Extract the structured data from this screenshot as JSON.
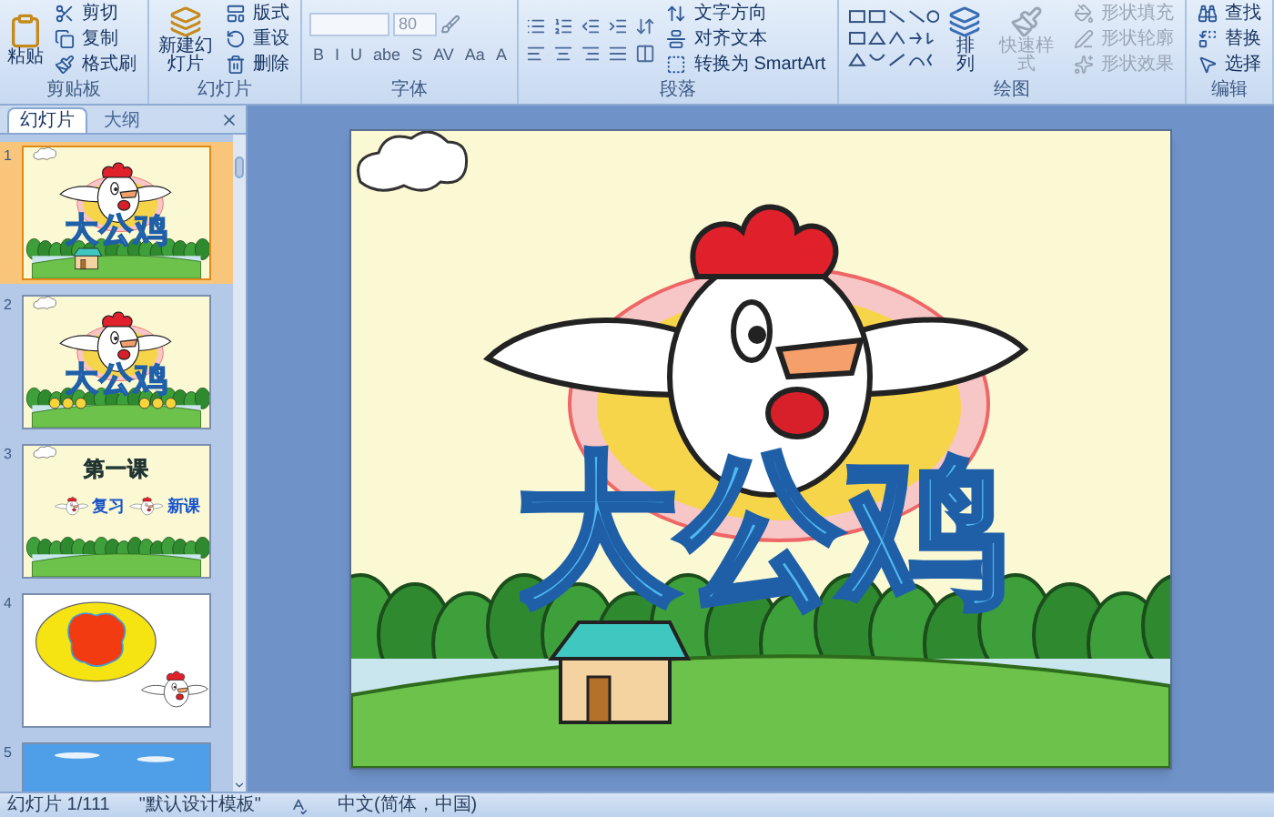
{
  "ribbon": {
    "clipboard": {
      "label": "剪贴板",
      "paste": "粘贴",
      "items": [
        {
          "label": "剪切",
          "kind": "cut"
        },
        {
          "label": "复制",
          "kind": "copy"
        },
        {
          "label": "格式刷",
          "kind": "brush"
        }
      ]
    },
    "slides": {
      "label": "幻灯片",
      "new_slide": "新建幻灯片",
      "items": [
        {
          "label": "版式",
          "kind": "layout"
        },
        {
          "label": "重设",
          "kind": "reset"
        },
        {
          "label": "删除",
          "kind": "delete"
        }
      ]
    },
    "font": {
      "label": "字体",
      "size": "80",
      "buttons": [
        "B",
        "I",
        "U",
        "abe",
        "S",
        "AV",
        "Aa",
        "A"
      ]
    },
    "paragraph": {
      "label": "段落",
      "items": [
        {
          "label": "文字方向",
          "kind": "direction"
        },
        {
          "label": "对齐文本",
          "kind": "align"
        },
        {
          "label": "转换为 SmartArt",
          "kind": "smartart"
        }
      ]
    },
    "drawing": {
      "label": "绘图",
      "arrange": "排列",
      "quick_styles": {
        "label": "快速样式",
        "disabled": true
      },
      "items": [
        {
          "label": "形状填充",
          "kind": "fill",
          "disabled": true
        },
        {
          "label": "形状轮廓",
          "kind": "outline",
          "disabled": true
        },
        {
          "label": "形状效果",
          "kind": "effect",
          "disabled": true
        }
      ]
    },
    "editing": {
      "label": "编辑",
      "items": [
        {
          "label": "查找",
          "kind": "find"
        },
        {
          "label": "替换",
          "kind": "replace"
        },
        {
          "label": "选择",
          "kind": "select"
        }
      ]
    }
  },
  "slide_panel": {
    "tabs": [
      {
        "label": "幻灯片",
        "selected": true
      },
      {
        "label": "大纲",
        "selected": false
      }
    ],
    "slides": [
      {
        "number": "1",
        "selected": true,
        "kind": "title",
        "texts": [
          "大公鸡"
        ]
      },
      {
        "number": "2",
        "selected": false,
        "kind": "family",
        "texts": [
          "大公鸡"
        ]
      },
      {
        "number": "3",
        "selected": false,
        "kind": "lesson",
        "texts": [
          "第一课",
          "复习",
          "新课"
        ]
      },
      {
        "number": "4",
        "selected": false,
        "kind": "speech"
      },
      {
        "number": "5",
        "selected": false,
        "kind": "sky"
      }
    ]
  },
  "slide": {
    "kind": "title",
    "texts": [
      "大公鸡"
    ]
  },
  "status_bar": {
    "slide_count": "幻灯片 1/111",
    "template": "\"默认设计模板\"",
    "language": "中文(简体，中国)"
  }
}
